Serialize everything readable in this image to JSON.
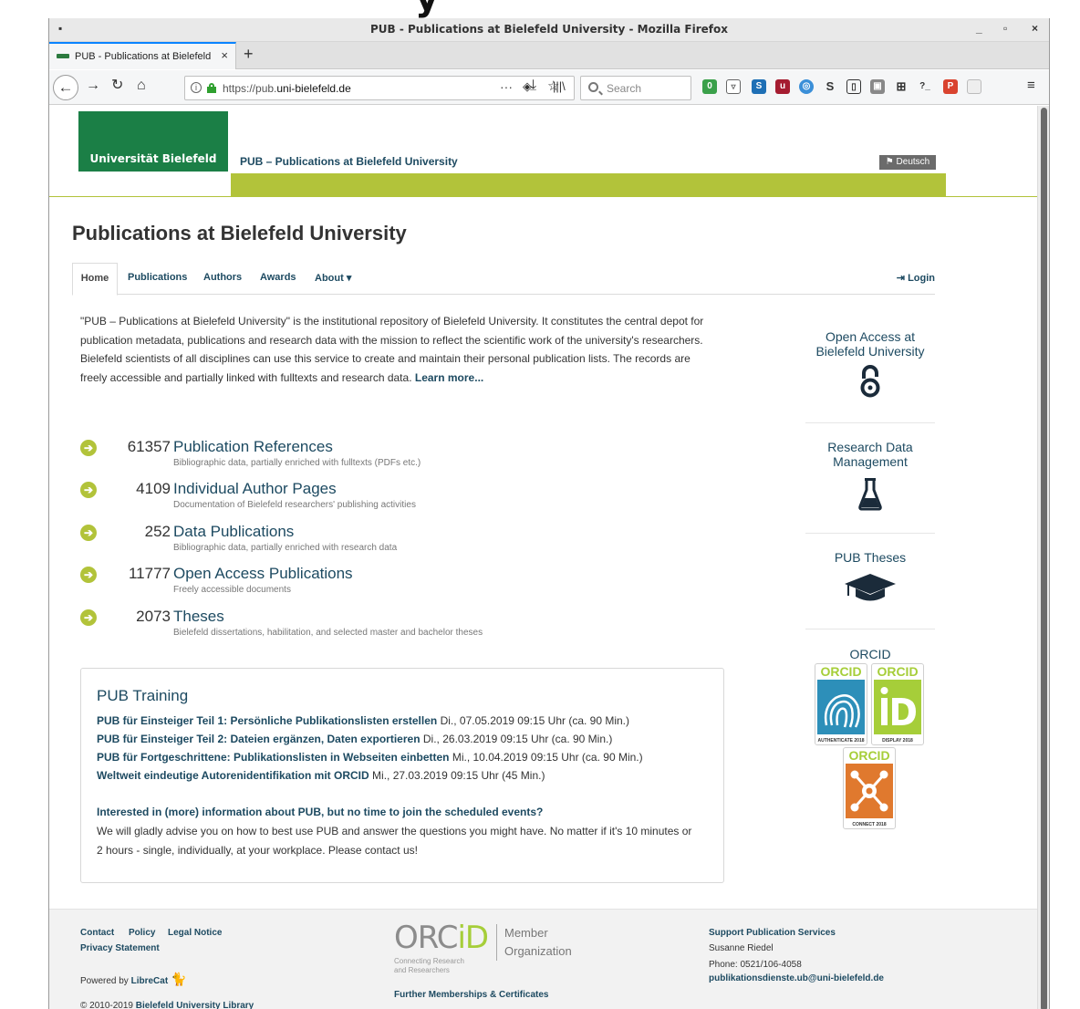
{
  "fragment_text": "y",
  "window": {
    "title": "PUB - Publications at Bielefeld University - Mozilla Firefox",
    "minimize": "_",
    "maximize": "▫",
    "close": "×"
  },
  "tab": {
    "title": "PUB - Publications at Bielefeld University",
    "close": "×",
    "new_tab": "+"
  },
  "nav": {
    "url_prefix": "https://pub.",
    "url_domain": "uni-bielefeld.de",
    "more": "···",
    "search_placeholder": "Search"
  },
  "site": {
    "logo_text": "Universität Bielefeld",
    "name": "PUB – Publications at Bielefeld University",
    "lang_button": "Deutsch",
    "heading": "Publications at Bielefeld University"
  },
  "nav_tabs": {
    "home": "Home",
    "publications": "Publications",
    "authors": "Authors",
    "awards": "Awards",
    "about": "About ▾",
    "login": "Login"
  },
  "intro": {
    "text": "\"PUB – Publications at Bielefeld University\" is the institutional repository of Bielefeld University. It constitutes the central depot for publication metadata, publications and research data with the mission to reflect the scientific work of the university's researchers. Bielefeld scientists of all disciplines can use this service to create and maintain their personal publication lists. The records are freely accessible and partially linked with fulltexts and research data.",
    "learn_more": "Learn more..."
  },
  "stats": [
    {
      "number": "61357",
      "label": "Publication References",
      "desc": "Bibliographic data, partially enriched with fulltexts (PDFs etc.)"
    },
    {
      "number": "4109",
      "label": "Individual Author Pages",
      "desc": "Documentation of Bielefeld researchers' publishing activities"
    },
    {
      "number": "252",
      "label": "Data Publications",
      "desc": "Bibliographic data, partially enriched with research data"
    },
    {
      "number": "11777",
      "label": "Open Access Publications",
      "desc": "Freely accessible documents"
    },
    {
      "number": "2073",
      "label": "Theses",
      "desc": "Bielefeld dissertations, habilitation, and selected master and bachelor theses"
    }
  ],
  "training": {
    "title": "PUB Training",
    "items": [
      {
        "link": "PUB für Einsteiger Teil 1: Persönliche Publikationslisten erstellen",
        "when": "Di., 07.05.2019 09:15 Uhr (ca. 90 Min.)"
      },
      {
        "link": "PUB für Einsteiger Teil 2: Dateien ergänzen, Daten exportieren",
        "when": "Di., 26.03.2019 09:15 Uhr (ca. 90 Min.)"
      },
      {
        "link": "PUB für Fortgeschrittene: Publikationslisten in Webseiten einbetten",
        "when": "Mi., 10.04.2019 09:15 Uhr (ca. 90 Min.)"
      },
      {
        "link": "Weltweit eindeutige Autorenidentifikation mit ORCID",
        "when": "Mi., 27.03.2019 09:15 Uhr (45 Min.)"
      }
    ],
    "info_title": "Interested in (more) information about PUB, but no time to join the scheduled events?",
    "info_text": "We will gladly advise you on how to best use PUB and answer the questions you might have. No matter if it's 10 minutes or 2 hours - single, individually, at your workplace. Please contact us!"
  },
  "sidebar": {
    "open_access": "Open Access at Bielefeld University",
    "research_data": "Research Data Management",
    "theses": "PUB Theses",
    "orcid": "ORCID",
    "badge_orcid": "ORCID",
    "badge_authenticate": "AUTHENTICATE 2018",
    "badge_display": "DISPLAY 2018",
    "badge_connect": "CONNECT 2018"
  },
  "footer": {
    "contact": "Contact",
    "policy": "Policy",
    "legal": "Legal Notice",
    "privacy": "Privacy Statement",
    "powered_by": "Powered by",
    "librecat": "LibreCat",
    "copyright": "© 2010-2019",
    "copyright_org": "Bielefeld University Library",
    "orcid_logo_or": "ORC",
    "orcid_logo_id": "iD",
    "orcid_tagline_1": "Connecting Research",
    "orcid_tagline_2": "and Researchers",
    "orcid_member_1": "Member",
    "orcid_member_2": "Organization",
    "further": "Further Memberships & Certificates",
    "support_title": "Support Publication Services",
    "support_name": "Susanne Riedel",
    "support_phone": "Phone: 0521/106-4058",
    "support_email": "publikationsdienste.ub@uni-bielefeld.de"
  },
  "colors": {
    "brand_green": "#1b7f46",
    "accent_lime": "#b2c33a",
    "link_blue": "#1d4a61",
    "orcid_green": "#a6ce39",
    "orcid_connect": "#e0792e",
    "orcid_auth": "#2d8fb9"
  }
}
